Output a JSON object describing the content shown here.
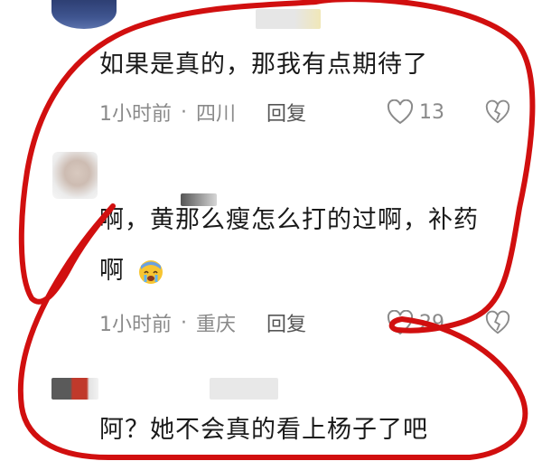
{
  "comments": [
    {
      "text": "如果是真的，那我有点期待了",
      "time": "1小时前",
      "separator": "·",
      "location": "四川",
      "reply_label": "回复",
      "likes": "13"
    },
    {
      "text_line1": "啊，黄那么瘦怎么打的过啊，补药",
      "text_line2": "啊",
      "emoji": "crying-face",
      "time": "1小时前",
      "separator": "·",
      "location": "重庆",
      "reply_label": "回复",
      "likes": "29"
    },
    {
      "text": "阿？她不会真的看上杨子了吧"
    }
  ],
  "colors": {
    "annotation": "#d10f0f",
    "text": "#1a1a1a",
    "meta": "#8a8a8a"
  },
  "icons": [
    "heart-icon",
    "broken-heart-icon",
    "crying-face-emoji"
  ]
}
